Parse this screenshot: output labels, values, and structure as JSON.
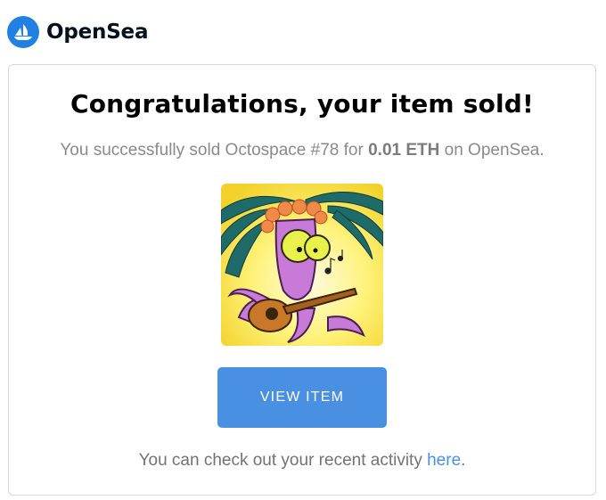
{
  "brand": {
    "name": "OpenSea",
    "icon": "opensea-logo-icon",
    "accent": "#2081e2"
  },
  "email": {
    "title": "Congratulations, your item sold!",
    "message": {
      "prefix": "You successfully sold Octospace #78 for ",
      "price": "0.01 ETH",
      "suffix": " on OpenSea."
    },
    "item_image": "octospace-78-image",
    "button_label": "VIEW ITEM",
    "button_color": "#4a90e2",
    "footer": {
      "prefix": "You can check out your recent activity ",
      "link_text": "here",
      "suffix": "."
    }
  }
}
